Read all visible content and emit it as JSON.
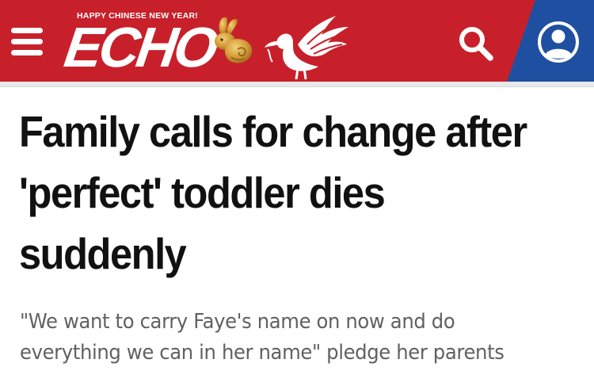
{
  "header": {
    "tagline": "HAPPY CHINESE NEW YEAR!",
    "logo_text": "ECHO",
    "menu_icon": "hamburger-menu-icon",
    "search_icon": "search-icon",
    "account_icon": "user-account-icon",
    "colors": {
      "brand_red": "#c8202a",
      "account_blue": "#1f4fa0",
      "gold": "#d9a441"
    }
  },
  "article": {
    "headline": "Family calls for change after 'perfect' toddler dies suddenly",
    "standfirst": "\"We want to carry Faye's name on now and do everything we can in her name\" pledge her parents"
  }
}
